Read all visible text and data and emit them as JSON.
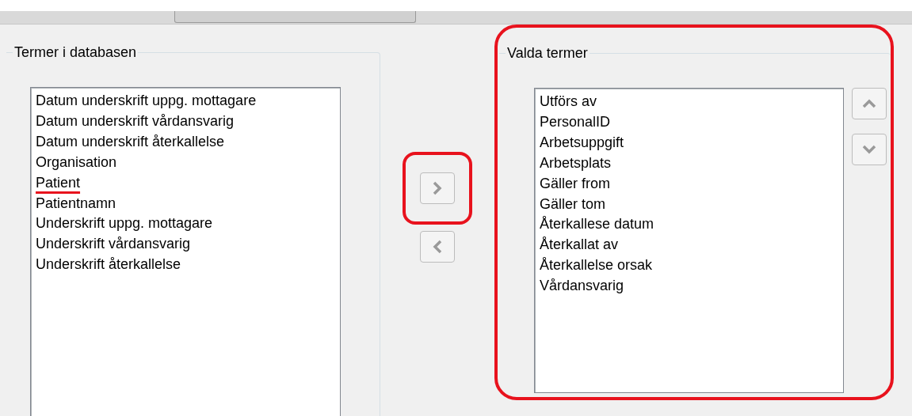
{
  "left_group": {
    "title": "Termer i databasen",
    "items": [
      {
        "label": "Datum underskrift uppg. mottagare",
        "marked": false
      },
      {
        "label": "Datum underskrift vårdansvarig",
        "marked": false
      },
      {
        "label": "Datum underskrift återkallelse",
        "marked": false
      },
      {
        "label": "Organisation",
        "marked": false
      },
      {
        "label": "Patient",
        "marked": true
      },
      {
        "label": "Patientnamn",
        "marked": false
      },
      {
        "label": "Underskrift uppg. mottagare",
        "marked": false
      },
      {
        "label": "Underskrift vårdansvarig",
        "marked": false
      },
      {
        "label": "Underskrift återkallelse",
        "marked": false
      }
    ]
  },
  "transfer_buttons": [
    {
      "kind": "right",
      "disabled": true,
      "highlighted": true
    },
    {
      "kind": "left",
      "disabled": true,
      "highlighted": false
    }
  ],
  "right_group": {
    "title": "Valda termer",
    "highlighted": true,
    "items": [
      {
        "label": "Utförs av"
      },
      {
        "label": "PersonalID"
      },
      {
        "label": "Arbetsuppgift"
      },
      {
        "label": "Arbetsplats"
      },
      {
        "label": "Gäller from"
      },
      {
        "label": "Gäller tom"
      },
      {
        "label": "Återkallese datum"
      },
      {
        "label": "Återkallat av"
      },
      {
        "label": "Återkallelse orsak"
      },
      {
        "label": "Vårdansvarig"
      }
    ],
    "order_buttons": [
      {
        "kind": "up",
        "disabled": true
      },
      {
        "kind": "down",
        "disabled": true
      }
    ]
  }
}
